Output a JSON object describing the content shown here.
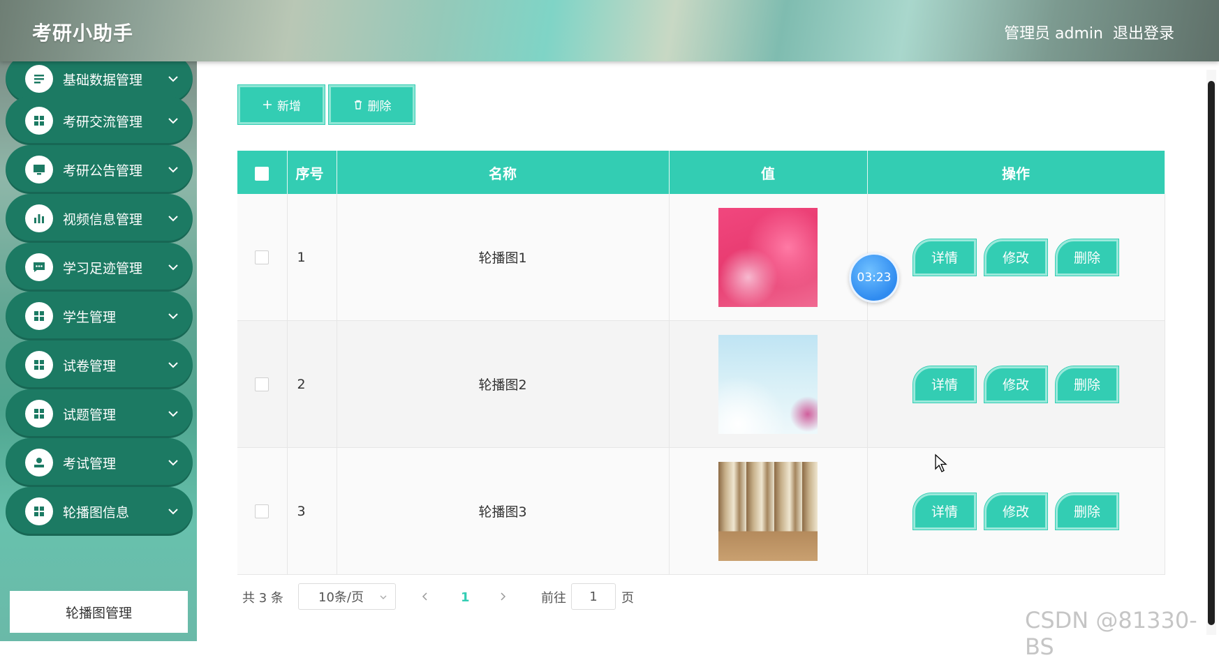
{
  "header": {
    "title": "考研小助手",
    "user": "管理员 admin",
    "logout": "退出登录"
  },
  "sidebar": {
    "items": [
      {
        "label": "基础数据管理",
        "icon": "list-icon"
      },
      {
        "label": "考研交流管理",
        "icon": "grid-icon"
      },
      {
        "label": "考研公告管理",
        "icon": "monitor-icon"
      },
      {
        "label": "视频信息管理",
        "icon": "bar-chart-icon"
      },
      {
        "label": "学习足迹管理",
        "icon": "chat-icon"
      },
      {
        "label": "学生管理",
        "icon": "grid-icon"
      },
      {
        "label": "试卷管理",
        "icon": "grid-icon"
      },
      {
        "label": "试题管理",
        "icon": "grid-icon"
      },
      {
        "label": "考试管理",
        "icon": "user-icon"
      },
      {
        "label": "轮播图信息",
        "icon": "grid-icon"
      }
    ],
    "submenu_active": "轮播图管理"
  },
  "toolbar": {
    "add_label": "新增",
    "delete_label": "删除"
  },
  "table": {
    "columns": [
      "序号",
      "名称",
      "值",
      "操作"
    ],
    "rows": [
      {
        "index": "1",
        "name": "轮播图1"
      },
      {
        "index": "2",
        "name": "轮播图2"
      },
      {
        "index": "3",
        "name": "轮播图3"
      }
    ],
    "actions": {
      "detail": "详情",
      "edit": "修改",
      "delete": "删除"
    }
  },
  "timer": "03:23",
  "pagination": {
    "total": "共 3 条",
    "page_size": "10条/页",
    "current_page": "1",
    "goto_prefix": "前往",
    "goto_value": "1",
    "goto_suffix": "页"
  },
  "watermark": "CSDN @81330-BS",
  "colors": {
    "accent": "#33cdb3",
    "menu_bg": "#1c7a63",
    "timer": "#2f8bf0"
  }
}
